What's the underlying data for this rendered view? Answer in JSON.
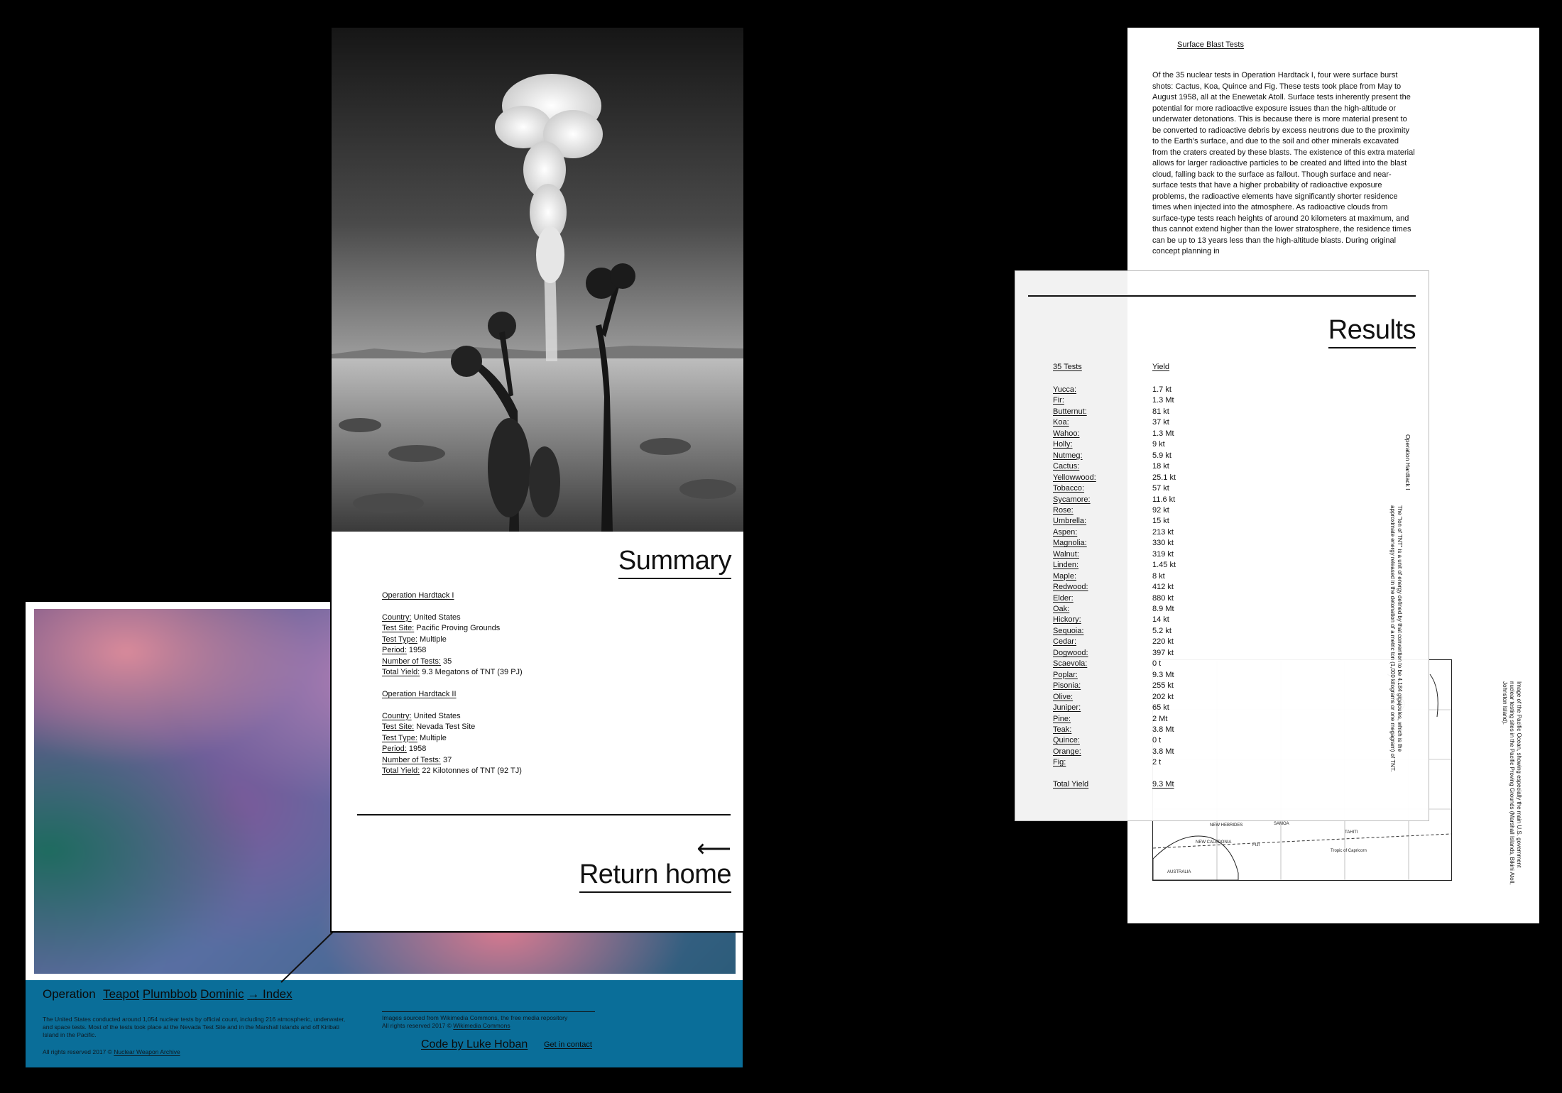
{
  "summary": {
    "heading": "Summary",
    "ops": [
      {
        "name": "Operation Hardtack I",
        "fields": [
          {
            "label": "Country:",
            "value": " United States"
          },
          {
            "label": "Test Site:",
            "value": " Pacific Proving Grounds"
          },
          {
            "label": "Test Type:",
            "value": " Multiple"
          },
          {
            "label": "Period:",
            "value": " 1958"
          },
          {
            "label": "Number of Tests:",
            "value": " 35"
          },
          {
            "label": "Total Yield:",
            "value": " 9.3 Megatons of TNT (39 PJ)"
          }
        ]
      },
      {
        "name": "Operation Hardtack II",
        "fields": [
          {
            "label": "Country:",
            "value": " United States"
          },
          {
            "label": "Test Site:",
            "value": " Nevada Test Site"
          },
          {
            "label": "Test Type:",
            "value": " Multiple"
          },
          {
            "label": "Period:",
            "value": " 1958"
          },
          {
            "label": "Number of Tests:",
            "value": " 37"
          },
          {
            "label": "Total Yield:",
            "value": " 22 Kilotonnes of TNT (92 TJ)"
          }
        ]
      }
    ],
    "return_arrow": "⟵",
    "return_label": "Return home"
  },
  "footer": {
    "nav": [
      "Operation",
      "Teapot",
      "Plumbbob",
      "Dominic",
      "→ Index"
    ],
    "about": "The United States conducted around 1,054 nuclear tests by official count, including 216 atmospheric, underwater, and space tests. Most of the tests took place at the Nevada Test Site and in the Marshall Islands and off Kiribati Island in the Pacific.",
    "rights_prefix": "All rights reserved 2017 © ",
    "rights_link": "Nuclear Weapon Archive",
    "images_line": "Images sourced from Wikimedia Commons, the free media repository",
    "images_rights_prefix": "All rights reserved 2017 © ",
    "images_rights_link": "Wikimedia Commons",
    "code_by": "Code by Luke Hoban",
    "contact": "Get in contact"
  },
  "doc": {
    "heading": "Surface Blast Tests",
    "body": "Of the 35 nuclear tests in Operation Hardtack I, four were surface burst shots: Cactus, Koa, Quince and Fig. These tests took place from May to August 1958, all at the Enewetak Atoll. Surface tests inherently present the potential for more radioactive exposure issues than the high-altitude or underwater detonations. This is because there is more material present to be converted to radioactive debris by excess neutrons due to the proximity to the Earth's surface, and due to the soil and other minerals excavated from the craters created by these blasts. The existence of this extra material allows for larger radioactive particles to be created and lifted into the blast cloud, falling back to the surface as fallout. Though surface and near-surface tests that have a higher probability of radioactive exposure problems, the radioactive elements have significantly shorter residence times when injected into the atmosphere. As radioactive clouds from surface-type tests reach heights of around 20 kilometers at maximum, and thus cannot extend higher than the lower stratosphere, the residence times can be up to 13 years less than the high-altitude blasts. During original concept planning in",
    "map_caption": "Image of the Pacific Ocean, showing especially the main U.S. government nuclear testing sites in the Pacific Proving Grounds (Marshall Islands, Bikini Atoll, Johnston Island).",
    "map_labels": [
      "NEW HEBRIDES",
      "NEW CALEDONIA",
      "SAMOA",
      "AUSTRALIA",
      "Tropic of Capricorn",
      "FIJI",
      "TAHITI"
    ]
  },
  "results": {
    "heading": "Results",
    "col_tests": "35 Tests",
    "col_yield": "Yield",
    "rows": [
      {
        "name": "Yucca:",
        "yield": "1.7 kt"
      },
      {
        "name": "Fir:",
        "yield": "1.3 Mt"
      },
      {
        "name": "Butternut:",
        "yield": "81 kt"
      },
      {
        "name": "Koa:",
        "yield": "37 kt"
      },
      {
        "name": "Wahoo:",
        "yield": "1.3 Mt"
      },
      {
        "name": "Holly:",
        "yield": "9 kt"
      },
      {
        "name": "Nutmeg:",
        "yield": "5.9 kt"
      },
      {
        "name": "Cactus:",
        "yield": "18 kt"
      },
      {
        "name": "Yellowwood:",
        "yield": "25.1 kt"
      },
      {
        "name": "Tobacco:",
        "yield": "57 kt"
      },
      {
        "name": "Sycamore:",
        "yield": "11.6 kt"
      },
      {
        "name": "Rose:",
        "yield": "92 kt"
      },
      {
        "name": "Umbrella:",
        "yield": "15 kt"
      },
      {
        "name": "Aspen:",
        "yield": "213 kt"
      },
      {
        "name": "Magnolia:",
        "yield": "330 kt"
      },
      {
        "name": "Walnut:",
        "yield": "319 kt"
      },
      {
        "name": "Linden:",
        "yield": "1.45 kt"
      },
      {
        "name": "Maple:",
        "yield": "8 kt"
      },
      {
        "name": "Redwood:",
        "yield": "412 kt"
      },
      {
        "name": "Elder:",
        "yield": "880 kt"
      },
      {
        "name": "Oak:",
        "yield": "8.9 Mt"
      },
      {
        "name": "Hickory:",
        "yield": "14 kt"
      },
      {
        "name": "Sequoia:",
        "yield": "5.2 kt"
      },
      {
        "name": "Cedar:",
        "yield": "220 kt"
      },
      {
        "name": "Dogwood:",
        "yield": "397 kt"
      },
      {
        "name": "Scaevola:",
        "yield": "0 t"
      },
      {
        "name": "Poplar:",
        "yield": "9.3 Mt"
      },
      {
        "name": "Pisonia:",
        "yield": "255 kt"
      },
      {
        "name": "Olive:",
        "yield": "202 kt"
      },
      {
        "name": "Juniper:",
        "yield": "65 kt"
      },
      {
        "name": "Pine:",
        "yield": "2 Mt"
      },
      {
        "name": "Teak:",
        "yield": "3.8 Mt"
      },
      {
        "name": "Quince:",
        "yield": "0 t"
      },
      {
        "name": "Orange:",
        "yield": "3.8 Mt"
      },
      {
        "name": "Fig:",
        "yield": "2 t"
      }
    ],
    "total_label": "Total Yield",
    "total_value": "9.3 Mt",
    "side_title": "Operation Hardtack I",
    "side_note": "The \"ton of TNT\" is a unit of energy defined by that convention to be 4.184 gigajoules, which is the approximate energy released in the detonation of a metric ton (1,000 kilograms or one megagram) of TNT."
  }
}
